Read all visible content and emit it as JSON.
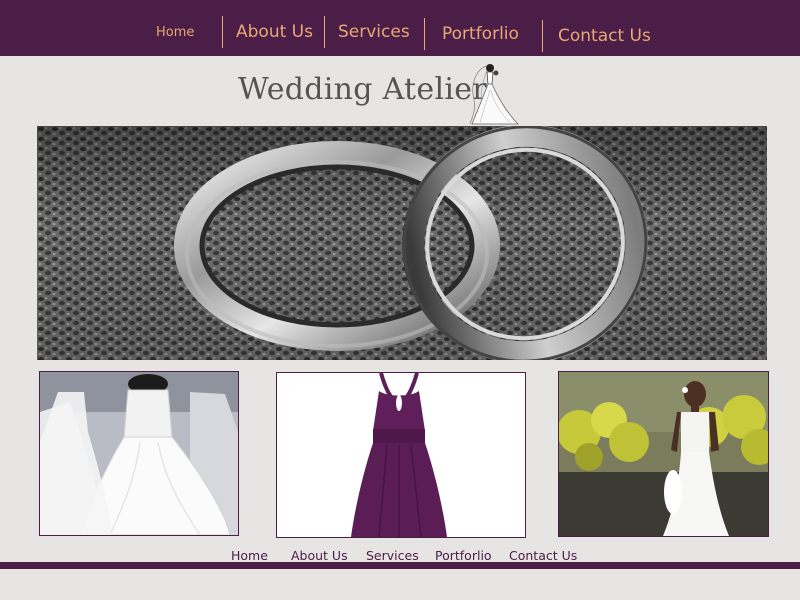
{
  "brand": {
    "name": "Wedding Atelier"
  },
  "nav": {
    "items": [
      {
        "label": "Home"
      },
      {
        "label": "About Us"
      },
      {
        "label": "Services"
      },
      {
        "label": "Portforlio"
      },
      {
        "label": "Contact Us"
      }
    ]
  },
  "footer_nav": {
    "items": [
      {
        "label": "Home"
      },
      {
        "label": "About Us"
      },
      {
        "label": "Services"
      },
      {
        "label": "Portforlio"
      },
      {
        "label": "Contact Us"
      }
    ]
  },
  "images": {
    "hero": "wedding-rings-photo",
    "thumb1": "white-wedding-gowns-photo",
    "thumb2": "purple-halter-dress-photo",
    "thumb3": "bride-with-bouquet-photo"
  },
  "colors": {
    "nav_bg": "#4b1e48",
    "nav_text": "#e8a873",
    "page_bg": "#e7e4e4",
    "footer_text": "#4b1e48"
  }
}
